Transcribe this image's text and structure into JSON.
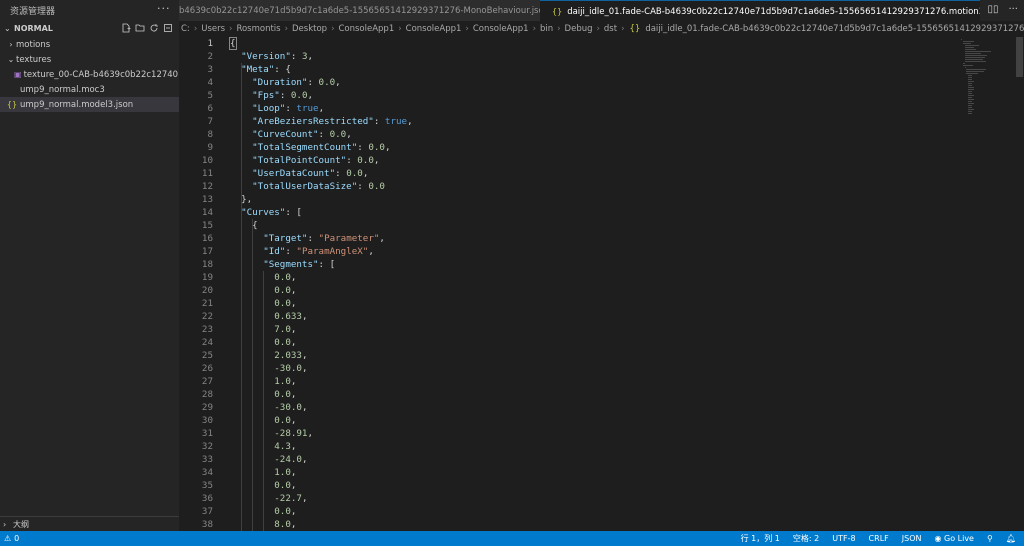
{
  "sidebar": {
    "title": "资源管理器",
    "more": "···",
    "section_label": "NORMAL",
    "items": [
      {
        "label": "motions",
        "type": "folder",
        "expanded": false
      },
      {
        "label": "textures",
        "type": "folder",
        "expanded": true
      },
      {
        "label": "texture_00-CAB-b4639c0b22c12740...",
        "type": "image-file"
      },
      {
        "label": "ump9_normal.moc3",
        "type": "file"
      },
      {
        "label": "ump9_normal.model3.json",
        "type": "json-file",
        "selected": true
      }
    ],
    "outline_label": "大纲"
  },
  "tabs": [
    {
      "label": "b4639c0b22c12740e71d5b9d7c1a6de5-15565651412929371276-MonoBehaviour.json",
      "active": false
    },
    {
      "label": "daiji_idle_01.fade-CAB-b4639c0b22c12740e71d5b9d7c1a6de5-15565651412929371276.motion3.json",
      "active": true,
      "close": "×"
    }
  ],
  "breadcrumb": [
    "C:",
    "Users",
    "Rosmontis",
    "Desktop",
    "ConsoleApp1",
    "ConsoleApp1",
    "ConsoleApp1",
    "bin",
    "Debug",
    "dst",
    "daiji_idle_01.fade-CAB-b4639c0b22c12740e71d5b9d7c1a6de5-15565651412929371276.motion3.json"
  ],
  "editor": {
    "lines": [
      "{",
      "  \"Version\": 3,",
      "  \"Meta\": {",
      "    \"Duration\": 0.0,",
      "    \"Fps\": 0.0,",
      "    \"Loop\": true,",
      "    \"AreBeziersRestricted\": true,",
      "    \"CurveCount\": 0.0,",
      "    \"TotalSegmentCount\": 0.0,",
      "    \"TotalPointCount\": 0.0,",
      "    \"UserDataCount\": 0.0,",
      "    \"TotalUserDataSize\": 0.0",
      "  },",
      "  \"Curves\": [",
      "    {",
      "      \"Target\": \"Parameter\",",
      "      \"Id\": \"ParamAngleX\",",
      "      \"Segments\": [",
      "        0.0,",
      "        0.0,",
      "        0.0,",
      "        0.633,",
      "        7.0,",
      "        0.0,",
      "        2.033,",
      "        -30.0,",
      "        1.0,",
      "        0.0,",
      "        -30.0,",
      "        0.0,",
      "        -28.91,",
      "        4.3,",
      "        -24.0,",
      "        1.0,",
      "        0.0,",
      "        -22.7,",
      "        0.0,",
      "        8.0,"
    ]
  },
  "status": {
    "left": "0",
    "position": "行 1，列 1",
    "spaces": "空格: 2",
    "encoding": "UTF-8",
    "eol": "CRLF",
    "language": "JSON",
    "golive": "Go Live"
  },
  "colors": {
    "accent": "#007acc",
    "key": "#9cdcfe",
    "string": "#ce9178",
    "number": "#b5cea8",
    "boolean": "#569cd6"
  }
}
